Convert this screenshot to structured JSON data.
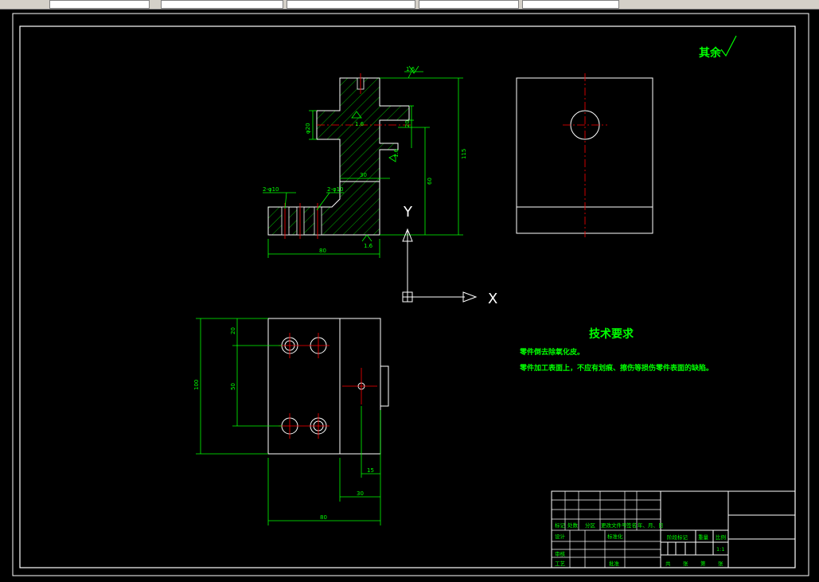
{
  "tabs": [
    {
      "label": ""
    },
    {
      "label": ""
    },
    {
      "label": ""
    },
    {
      "label": ""
    },
    {
      "label": ""
    }
  ],
  "drawing": {
    "surface_note": "其余",
    "tech_title": "技术要求",
    "tech_lines": [
      "零件倒去除氧化皮。",
      "零件加工表面上，不应有划痕、擦伤等损伤零件表面的缺陷。"
    ],
    "ucs_x": "X",
    "ucs_y": "Y",
    "roughness": [
      "1.6",
      "1.6",
      "1.6",
      "1.6"
    ],
    "dims": {
      "hole_2x10_a": "2-φ10",
      "hole_2x10_b": "2-φ10",
      "height_total": "115",
      "height_mid": "60",
      "step": "30",
      "width_bottom": "80",
      "bore": "φ20",
      "small": "20",
      "plan_height": "100",
      "plan_spacing": "50",
      "plan_top": "20",
      "plan_w1": "15",
      "plan_w2": "30",
      "plan_w3": "80"
    },
    "title_block": {
      "row_labels": [
        "标记",
        "处数",
        "分区",
        "更改文件号",
        "签名",
        "年、月、日"
      ],
      "design": "设计",
      "standard": "标准化",
      "review": "审核",
      "process": "工艺",
      "approve": "批准",
      "stage": "阶段标记",
      "weight": "重量",
      "scale": "比例",
      "scale_value": "1:1",
      "sheets": [
        "共",
        "张",
        "第",
        "张"
      ]
    }
  }
}
